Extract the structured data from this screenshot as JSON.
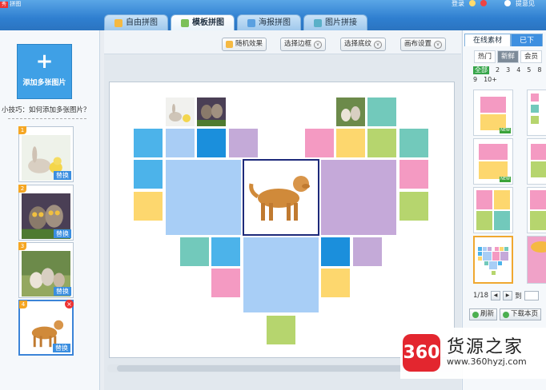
{
  "window": {
    "app_name": "拼图",
    "top_links": [
      "登录",
      "提意见"
    ]
  },
  "tabs": [
    {
      "label": "自由拼图",
      "icon_color": "#f5b942",
      "active": false
    },
    {
      "label": "模板拼图",
      "icon_color": "#7cc05a",
      "active": true
    },
    {
      "label": "海报拼图",
      "icon_color": "#5aa0e0",
      "active": false
    },
    {
      "label": "图片拼接",
      "icon_color": "#5ab0c8",
      "active": false
    }
  ],
  "left_panel": {
    "add_button_label": "添加多张图片",
    "add_button_icon": "+",
    "tip": "小技巧：如何添加多张图片？",
    "replace_label": "替换",
    "thumbnails": [
      {
        "num": "1",
        "subject": "rabbit-and-chick"
      },
      {
        "num": "2",
        "subject": "owls"
      },
      {
        "num": "3",
        "subject": "kittens"
      },
      {
        "num": "4",
        "subject": "golden-retriever",
        "selected": true
      }
    ]
  },
  "toolbar": {
    "random": "随机效果",
    "border": "选择边框",
    "background": "选择底纹",
    "canvas": "画布设置"
  },
  "canvas": {
    "colors": {
      "blue": "#4cb3ea",
      "lightblue": "#a9cdf5",
      "pink": "#f49ac2",
      "yellow": "#fdd76e",
      "green": "#b6d56e",
      "teal": "#72c9bb",
      "purple": "#c4aad8",
      "bigblue": "#a8cef6",
      "bigpurple": "#c5a9d9"
    }
  },
  "right_panel": {
    "tabs": [
      "在线素材",
      "已下"
    ],
    "sub_tabs": [
      "热门",
      "新鲜",
      "会员"
    ],
    "counts": [
      "全部",
      "2",
      "3",
      "4",
      "5",
      "8",
      "9",
      "10+"
    ],
    "pager": {
      "page": "1/18",
      "goto": "到"
    },
    "refresh": "刷新",
    "download": "下载本页"
  },
  "watermark": {
    "badge": "360",
    "name": "货源之家",
    "url": "www.360hyzj.com"
  }
}
